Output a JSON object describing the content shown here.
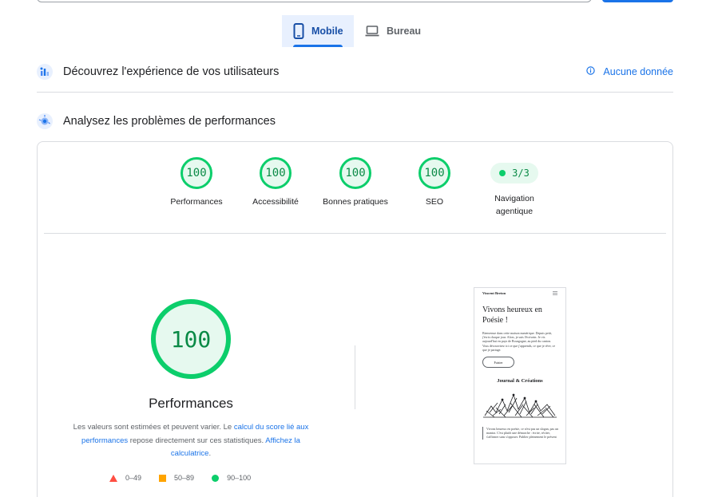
{
  "device_tabs": [
    {
      "label": "Mobile",
      "icon": "smartphone-icon",
      "active": true
    },
    {
      "label": "Bureau",
      "icon": "laptop-icon",
      "active": false
    }
  ],
  "field_section": {
    "title": "Découvrez l'expérience de vos utilisateurs",
    "icon": "users-chart-icon",
    "right_link": "Aucune donnée",
    "right_icon": "info-icon"
  },
  "lab_section": {
    "title": "Analysez les problèmes de performances",
    "icon": "lab-sparkle-icon"
  },
  "gauges": [
    {
      "score": "100",
      "label": "Performances"
    },
    {
      "score": "100",
      "label": "Accessibilité"
    },
    {
      "score": "100",
      "label": "Bonnes pratiques"
    },
    {
      "score": "100",
      "label": "SEO"
    }
  ],
  "agentic": {
    "value": "3/3",
    "label_line1": "Navigation",
    "label_line2": "agentique"
  },
  "performance_detail": {
    "score": "100",
    "title": "Performances",
    "desc_part1": "Les valeurs sont estimées et peuvent varier. Le ",
    "desc_link1": "calcul du score lié aux performances",
    "desc_part2": " repose directement sur ces statistiques. ",
    "desc_link2": "Affichez la calculatrice",
    "desc_end": "."
  },
  "legend": [
    {
      "range": "0–49",
      "shape": "triangle",
      "color": "#ff4e42"
    },
    {
      "range": "50–89",
      "shape": "square",
      "color": "#ffa400"
    },
    {
      "range": "90–100",
      "shape": "circle",
      "color": "#0cce6b"
    }
  ],
  "screenshot_preview": {
    "site_name": "Vincent Breton",
    "headline_line1": "Vivons heureux en",
    "headline_line2": "Poésie !",
    "intro": "Bienvenue dans cette maison numérique. Depuis petit, j'écris chaque jour. Alors, je suis l'écrivain. Je vis aujourd'hui en pays de Bourgogne, au pied du canton. Vous découvrirez ici ce que j'apprends, ce que je rêve, ce que je partage.",
    "button": "Fuisier",
    "section_title": "Journal & Créations",
    "footer_text": "Vivons heureux en poésie, ce n'est pas un slogan, pas un mantra. C'est plutôt une démarche : écrire, réciter, s'affirmer sans s'opposer. Publier pleinement le présent"
  },
  "colors": {
    "accent": "#1a73e8",
    "pass_green": "#0cce6b",
    "pass_bg": "#e6f9ef",
    "pass_text": "#0a8a46"
  }
}
